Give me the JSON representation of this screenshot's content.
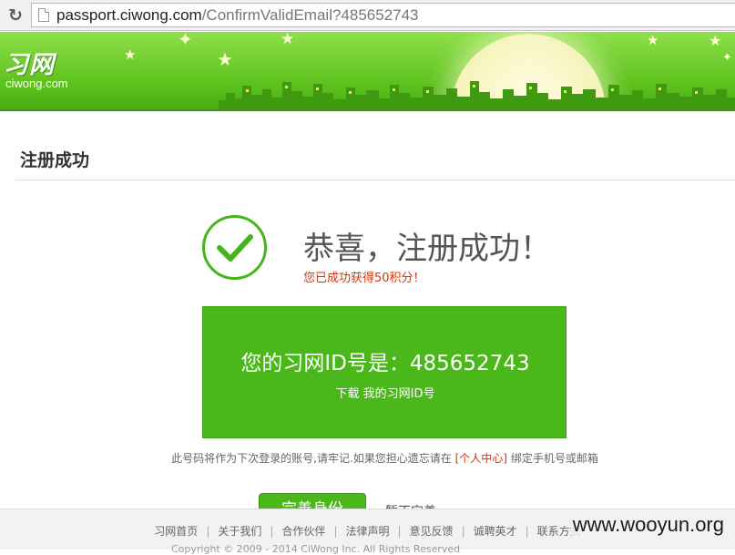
{
  "browser": {
    "reload_icon": "reload-icon",
    "url_domain": "passport.ciwong.com",
    "url_path": "/ConfirmValidEmail?485652743"
  },
  "banner": {
    "logo_text": "习网",
    "logo_sub": "ciwong.com",
    "colors": {
      "green_light": "#8ee04a",
      "green_dark": "#4aad12"
    }
  },
  "page": {
    "section_title": "注册成功",
    "headline": "恭喜，注册成功！",
    "points_message": "您已成功获得50积分！",
    "id_label": "您的习网ID号是：485652743",
    "download_label": "下载 我的习网ID号",
    "notice_prefix": "此号码将作为下次登录的账号,请牢记.如果您担心遗忘请在",
    "notice_link": "[个人中心]",
    "notice_suffix": "绑定手机号或邮箱",
    "primary_button": "完善身份",
    "secondary_link": "暂不完善",
    "colors": {
      "accent_green": "#4ab81a",
      "alert_red": "#d4330f"
    }
  },
  "footer": {
    "links": [
      "习网首页",
      "关于我们",
      "合作伙伴",
      "法律声明",
      "意见反馈",
      "诚聘英才",
      "联系方式"
    ],
    "copyright": "Copyright © 2009 - 2014 CiWong Inc. All Rights Reserved"
  },
  "watermark": "www.wooyun.org"
}
